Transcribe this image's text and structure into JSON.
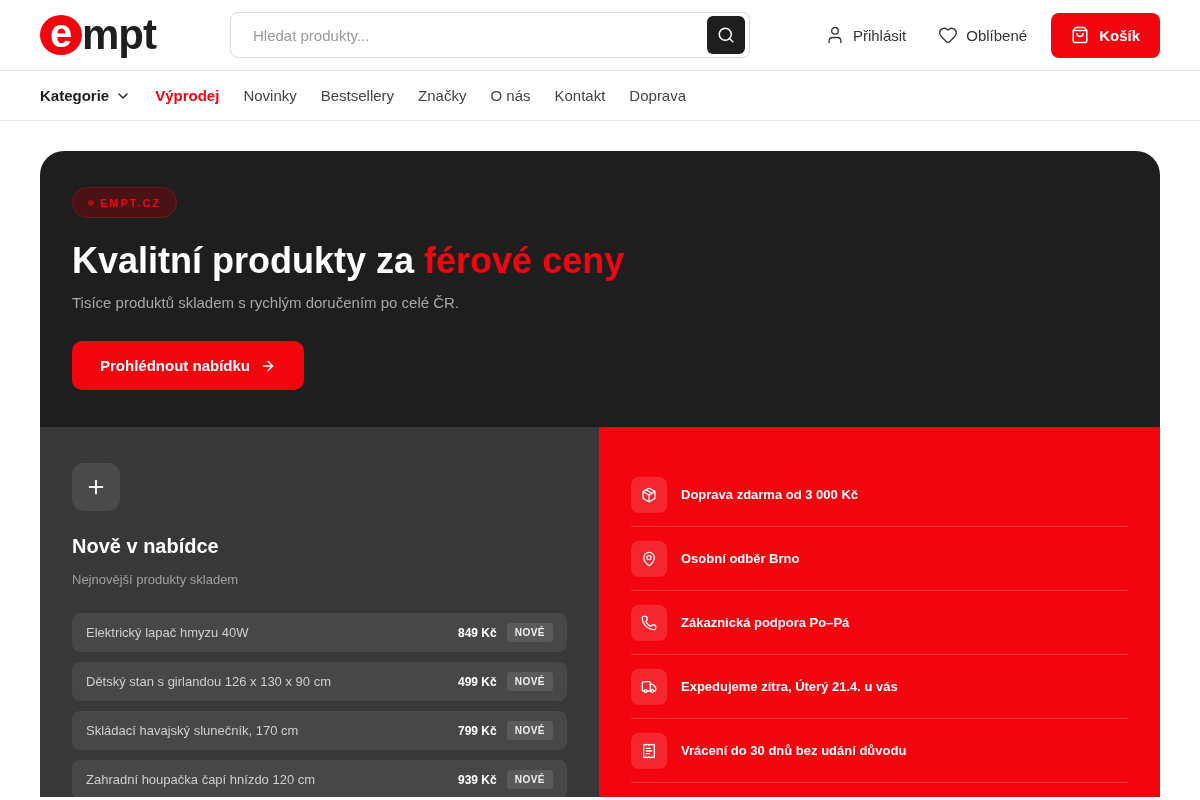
{
  "header": {
    "logo": {
      "mark": "e",
      "text": "mpt"
    },
    "search": {
      "placeholder": "Hledat produkty..."
    },
    "actions": [
      {
        "kind": "user",
        "label": "Přihlásit"
      },
      {
        "kind": "heart",
        "label": "Oblíbené"
      },
      {
        "kind": "cart",
        "label": "Košík"
      }
    ]
  },
  "nav": [
    {
      "label": "Kategorie",
      "kind": "dropdown",
      "selected": false
    },
    {
      "label": "Výprodej",
      "kind": "link",
      "selected": true
    },
    {
      "label": "Novinky",
      "kind": "link",
      "selected": false
    },
    {
      "label": "Bestsellery",
      "kind": "link",
      "selected": false
    },
    {
      "label": "Značky",
      "kind": "link",
      "selected": false
    },
    {
      "label": "O nás",
      "kind": "link",
      "selected": false
    },
    {
      "label": "Kontakt",
      "kind": "link",
      "selected": false
    },
    {
      "label": "Doprava",
      "kind": "link",
      "selected": false
    }
  ],
  "hero": {
    "badge": "EMPT.CZ",
    "title": "Kvalitní produkty za",
    "title_accent": "férové ceny",
    "subtitle": "Tisíce produktů skladem s rychlým doručením po celé ČR.",
    "cta": "Prohlédnout nabídku"
  },
  "new_products": {
    "title": "Nově v nabídce",
    "subtitle": "Nejnovější produkty skladem",
    "items": [
      {
        "name": "Elektrický lapač hmyzu 40W",
        "price": "849 Kč",
        "tag": "NOVÉ"
      },
      {
        "name": "Dětský stan s girlandou 126 x 130 x 90 cm",
        "price": "499 Kč",
        "tag": "NOVÉ"
      },
      {
        "name": "Skládací havajský slunečník, 170 cm",
        "price": "799 Kč",
        "tag": "NOVÉ"
      },
      {
        "name": "Zahradní houpačka čapí hnízdo 120 cm",
        "price": "939 Kč",
        "tag": "NOVÉ"
      }
    ]
  },
  "features": [
    {
      "kind": "box",
      "text": "Doprava zdarma od 3 000 Kč"
    },
    {
      "kind": "pin",
      "text": "Osobní odběr Brno"
    },
    {
      "kind": "phone",
      "text": "Zákaznická podpora Po–Pá"
    },
    {
      "kind": "truck",
      "text": "Expedujeme zítra, Úterý 21.4. u vás"
    },
    {
      "kind": "return",
      "text": "Vrácení do 30 dnů bez udání důvodu"
    }
  ]
}
